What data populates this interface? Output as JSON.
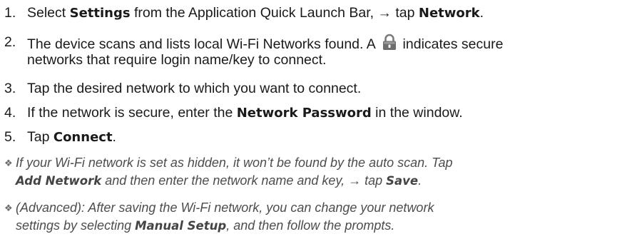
{
  "steps": [
    {
      "number": "1.",
      "line1": {
        "pre": "Select ",
        "b1": "Settings",
        "mid": " from the Application Quick Launch Bar, → tap ",
        "b2": "Network",
        "post": "."
      }
    },
    {
      "number": "2.",
      "line1": {
        "pre": "The device scans and lists local Wi-Fi Networks found. A ",
        "post": " indicates secure"
      },
      "line2": "networks that require login name/key to connect.",
      "icon": "lock-icon"
    },
    {
      "number": "3.",
      "line1": {
        "pre": "Tap the desired network to which you want to connect."
      }
    },
    {
      "number": "4.",
      "line1": {
        "pre": "If the network is secure, enter the ",
        "b1": "Network Password",
        "post": " in the window."
      }
    },
    {
      "number": "5.",
      "line1": {
        "pre": "Tap ",
        "b1": "Connect",
        "post": "."
      }
    }
  ],
  "notes": [
    {
      "bullet": "❖",
      "line1": "If your Wi-Fi network is set as hidden, it won’t be found by the auto scan. Tap",
      "line2": {
        "b1": "Add Network",
        "mid": " and then enter the network name and key, → tap ",
        "b2": "Save",
        "post": "."
      }
    },
    {
      "bullet": "❖",
      "line1": "(Advanced): After saving the Wi-Fi network, you can change your network",
      "line2": {
        "pre": "settings by selecting ",
        "b1": "Manual Setup",
        "post": ", and then follow the prompts."
      }
    }
  ],
  "colors": {
    "text": "#1a1a1a",
    "note_text": "#4d4d4d",
    "lock_icon": "#6e6e6e"
  }
}
